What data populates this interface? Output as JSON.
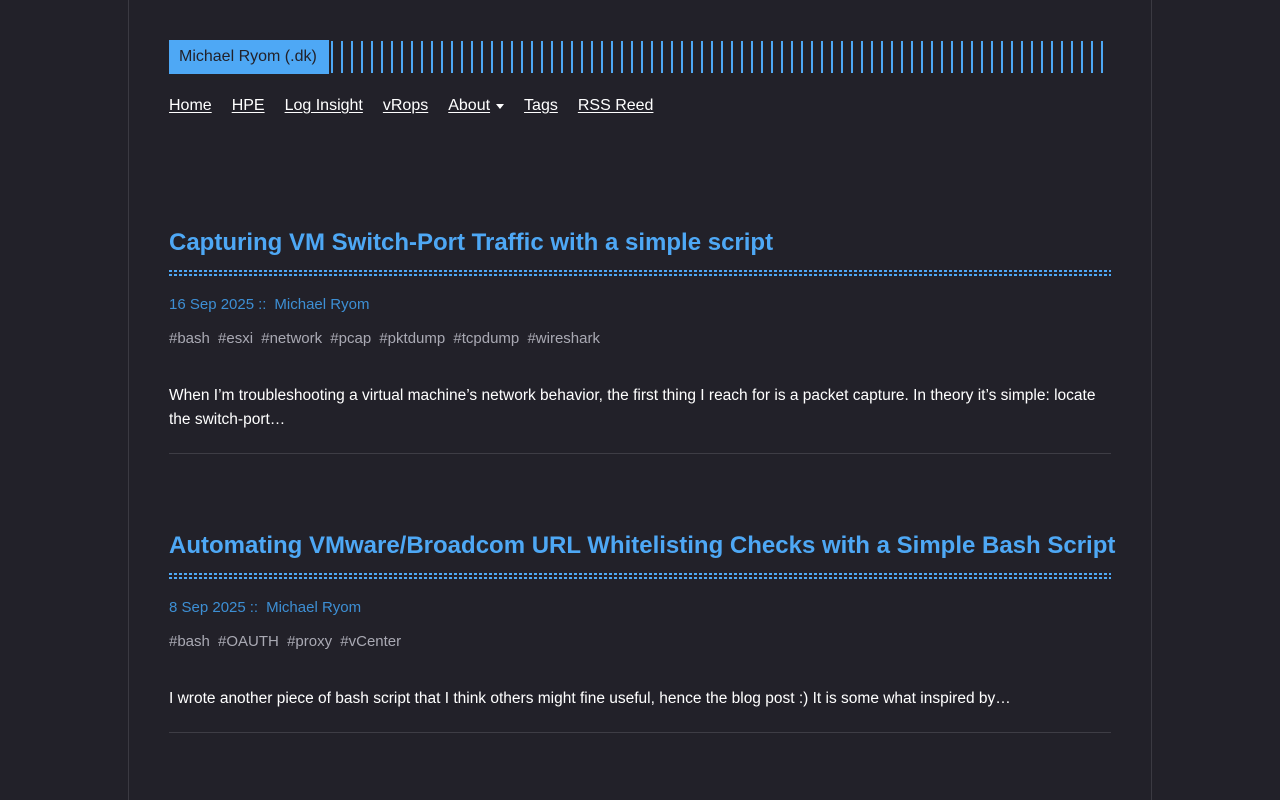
{
  "header": {
    "logo_text": "Michael Ryom (.dk)"
  },
  "nav": {
    "items": [
      {
        "label": "Home"
      },
      {
        "label": "HPE"
      },
      {
        "label": "Log Insight"
      },
      {
        "label": "vRops"
      },
      {
        "label": "About"
      },
      {
        "label": "Tags"
      },
      {
        "label": "RSS Reed"
      }
    ]
  },
  "posts": [
    {
      "title": "Capturing VM Switch-Port Traffic with a simple script",
      "date": "16 Sep 2025",
      "separator": "::",
      "author": "Michael Ryom",
      "tags": [
        "#bash",
        "#esxi",
        "#network",
        "#pcap",
        "#pktdump",
        "#tcpdump",
        "#wireshark"
      ],
      "excerpt": "When I’m troubleshooting a virtual machine’s network behavior, the first thing I reach for is a packet capture. In theory it’s simple: locate the switch-port…"
    },
    {
      "title": "Automating VMware/Broadcom URL Whitelisting Checks with a Simple Bash Script",
      "date": "8 Sep 2025",
      "separator": "::",
      "author": "Michael Ryom",
      "tags": [
        "#bash",
        "#OAUTH",
        "#proxy",
        "#vCenter"
      ],
      "excerpt": "I wrote another piece of bash script that I think others might fine useful, hence the blog post :) It is some what inspired by…"
    }
  ],
  "colors": {
    "background": "#222129",
    "accent": "#4ea8f5",
    "meta": "#3d8fd4",
    "tags": "#a9a9b3",
    "text": "#ffffff"
  }
}
